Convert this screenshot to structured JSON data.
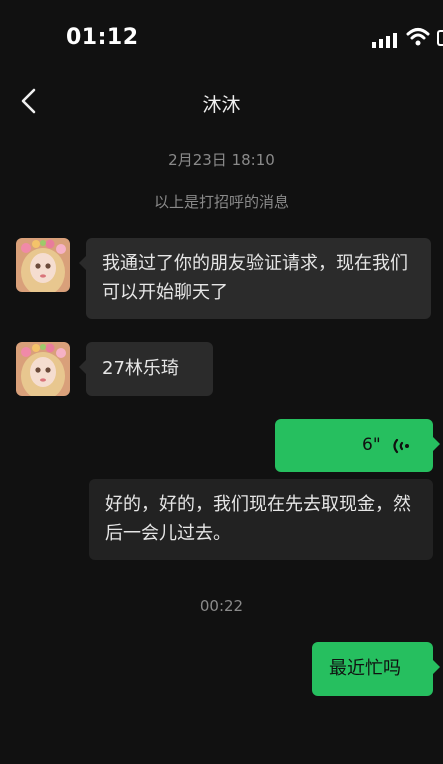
{
  "status_bar": {
    "time": "01:12"
  },
  "header": {
    "title": "沐沐"
  },
  "chat": {
    "timestamp_1": "2月23日 18:10",
    "system_notice": "以上是打招呼的消息",
    "messages": [
      {
        "side": "left",
        "text": "我通过了你的朋友验证请求，现在我们可以开始聊天了"
      },
      {
        "side": "left",
        "text": "27林乐琦"
      },
      {
        "side": "right",
        "type": "voice",
        "duration": "6\""
      },
      {
        "side": "left",
        "text": "好的，好的，我们现在先去取现金，然后一会儿过去。"
      }
    ],
    "timestamp_2": "00:22",
    "last_message": "最近忙吗"
  },
  "colors": {
    "background": "#111111",
    "incoming_bubble": "#2b2b2b",
    "outgoing_bubble": "#26bf5f",
    "muted_text": "#8a8a8a"
  }
}
